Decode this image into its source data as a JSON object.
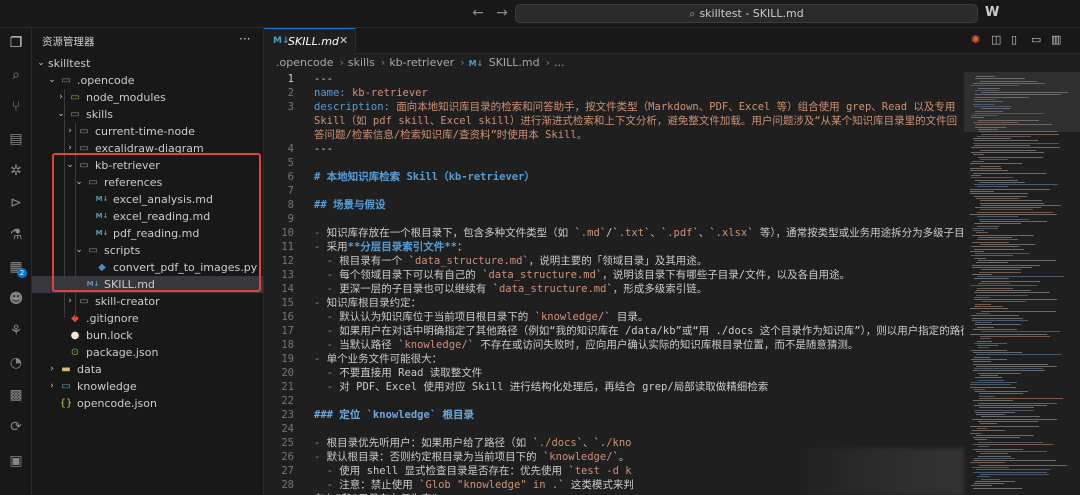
{
  "titlebar": {
    "search_text": "skilltest - SKILL.md",
    "back_icon": "arrow-left-icon",
    "forward_icon": "arrow-right-icon",
    "logo": "W"
  },
  "activitybar": {
    "items": [
      "explorer-icon",
      "search-icon",
      "source-control-icon",
      "run-debug-icon",
      "extensions-icon",
      "remote-icon",
      "testing-icon",
      "extension-badge-icon",
      "accounts-icon",
      "git-graph-icon",
      "timeline-icon",
      "grid-icon",
      "github-icon",
      "database-icon"
    ],
    "badge": "2"
  },
  "sidebar": {
    "title": "资源管理器",
    "more": "···",
    "root": "skilltest",
    "tree": [
      {
        "label": "opencode",
        "prefix": ".",
        "depth": 1,
        "type": "folder",
        "open": true
      },
      {
        "label": "node_modules",
        "depth": 2,
        "type": "folder-green",
        "open": false
      },
      {
        "label": "skills",
        "depth": 2,
        "type": "folder",
        "open": true
      },
      {
        "label": "current-time-node",
        "depth": 3,
        "type": "folder",
        "open": false
      },
      {
        "label": "excalidraw-diagram",
        "depth": 3,
        "type": "folder",
        "open": false
      },
      {
        "label": "kb-retriever",
        "depth": 3,
        "type": "folder",
        "open": true
      },
      {
        "label": "references",
        "depth": 4,
        "type": "folder",
        "open": true
      },
      {
        "label": "excel_analysis.md",
        "depth": 5,
        "type": "md"
      },
      {
        "label": "excel_reading.md",
        "depth": 5,
        "type": "md"
      },
      {
        "label": "pdf_reading.md",
        "depth": 5,
        "type": "md"
      },
      {
        "label": "scripts",
        "depth": 4,
        "type": "folder",
        "open": true
      },
      {
        "label": "convert_pdf_to_images.py",
        "depth": 5,
        "type": "py"
      },
      {
        "label": "SKILL.md",
        "depth": 4,
        "type": "md",
        "selected": true
      },
      {
        "label": "skill-creator",
        "depth": 3,
        "type": "folder",
        "open": false
      },
      {
        "label": ".gitignore",
        "depth": 2,
        "type": "git"
      },
      {
        "label": "bun.lock",
        "depth": 2,
        "type": "bun"
      },
      {
        "label": "package.json",
        "depth": 2,
        "type": "json"
      },
      {
        "label": "data",
        "depth": 1,
        "type": "folder-yellow",
        "open": false
      },
      {
        "label": "knowledge",
        "depth": 1,
        "type": "folder-blue",
        "open": false
      },
      {
        "label": "opencode.json",
        "depth": 1,
        "type": "json-braces"
      }
    ]
  },
  "editor": {
    "tab_label": "SKILL.md",
    "tab_icon": "M↓",
    "breadcrumb": [
      ".opencode",
      "skills",
      "kb-retriever",
      "SKILL.md",
      "..."
    ],
    "lines": [
      {
        "n": "1",
        "html": "---"
      },
      {
        "n": "2",
        "html": "<span class='key'>name:</span> <span class='str'>kb-retriever</span>"
      },
      {
        "n": "3",
        "html": "<span class='key'>description:</span> <span class='str'>面向本地知识库目录的检索和问答助手，按文件类型（Markdown、PDF、Excel 等）组合使用 grep、Read 以及专用 Skill（如 pdf skill、Excel skill）进行渐进式检索和上下文分析，避免整文件加载。用户问题涉及“从某个知识库目录里的文件回答问题/检索信息/检索知识库/查资料”时使用本 Skill。</span>",
        "wrap": 3
      },
      {
        "n": "4",
        "html": "---"
      },
      {
        "n": "5",
        "html": ""
      },
      {
        "n": "6",
        "html": "<span class='hd'># 本地知识库检索 Skill（kb-retriever）</span>"
      },
      {
        "n": "7",
        "html": ""
      },
      {
        "n": "8",
        "html": "<span class='hd'>## 场景与假设</span>"
      },
      {
        "n": "9",
        "html": ""
      },
      {
        "n": "10",
        "html": "<span class='bullet'>-</span> 知识库存放在一个根目录下，包含多种文件类型（如 `<span class='code'>.md</span>`/`<span class='code'>.txt</span>`、`<span class='code'>.pdf</span>`、`<span class='code'>.xlsx</span>` 等），通常按类型或业务用途拆分为多级子目录。"
      },
      {
        "n": "11",
        "html": "<span class='bullet'>-</span> 采用<span class='bold'>**分层目录索引文件**</span>："
      },
      {
        "n": "12",
        "html": "  <span class='bullet'>-</span> 根目录有一个 `<span class='code'>data_structure.md</span>`，说明主要的「领域目录」及其用途。"
      },
      {
        "n": "13",
        "html": "  <span class='bullet'>-</span> 每个领域目录下可以有自己的 `<span class='code'>data_structure.md</span>`，说明该目录下有哪些子目录/文件，以及各自用途。"
      },
      {
        "n": "14",
        "html": "  <span class='bullet'>-</span> 更深一层的子目录也可以继续有 `<span class='code'>data_structure.md</span>`，形成多级索引链。"
      },
      {
        "n": "15",
        "html": "<span class='bullet'>-</span> 知识库根目录约定："
      },
      {
        "n": "16",
        "html": "  <span class='bullet'>-</span> 默认认为知识库位于当前项目根目录下的 `<span class='code'>knowledge/</span>` 目录。"
      },
      {
        "n": "17",
        "html": "  <span class='bullet'>-</span> 如果用户在对话中明确指定了其他路径（例如“我的知识库在 /data/kb”或“用 ./docs 这个目录作为知识库”），则以用户指定的路径作为根目录。"
      },
      {
        "n": "18",
        "html": "  <span class='bullet'>-</span> 当默认路径 `<span class='code'>knowledge/</span>` 不存在或访问失败时，应向用户确认实际的知识库根目录位置，而不是随意猜测。"
      },
      {
        "n": "19",
        "html": "<span class='bullet'>-</span> 单个业务文件可能很大："
      },
      {
        "n": "20",
        "html": "  <span class='bullet'>-</span> 不要直接用 Read 读取整文件"
      },
      {
        "n": "21",
        "html": "  <span class='bullet'>-</span> 对 PDF、Excel 使用对应 Skill 进行结构化处理后，再结合 grep/局部读取做精细检索"
      },
      {
        "n": "22",
        "html": ""
      },
      {
        "n": "23",
        "html": "<span class='hdc'>### 定位 `knowledge` 根目录</span>"
      },
      {
        "n": "24",
        "html": ""
      },
      {
        "n": "25",
        "html": "<span class='bullet'>-</span> 根目录优先听用户：如果用户给了路径（如 `<span class='code'>./docs</span>`、`<span class='code'>./kno</span>"
      },
      {
        "n": "26",
        "html": "<span class='bullet'>-</span> 默认根目录：否则约定根目录为当前项目下的 `<span class='code'>knowledge/</span>`。"
      },
      {
        "n": "27",
        "html": "  <span class='bullet'>-</span> 使用 shell 显式检查目录是否存在：优先使用 `<span class='code'>test -d k</span>"
      },
      {
        "n": "28",
        "html": "  <span class='bullet'>-</span> 注意：禁止使用 `<span class='code'>Glob \"knowledge\" in .</span>` 这类模式来判"
      },
      {
        "n": "",
        "html": "存在\"和\"目录存在但为空\"。"
      }
    ]
  }
}
